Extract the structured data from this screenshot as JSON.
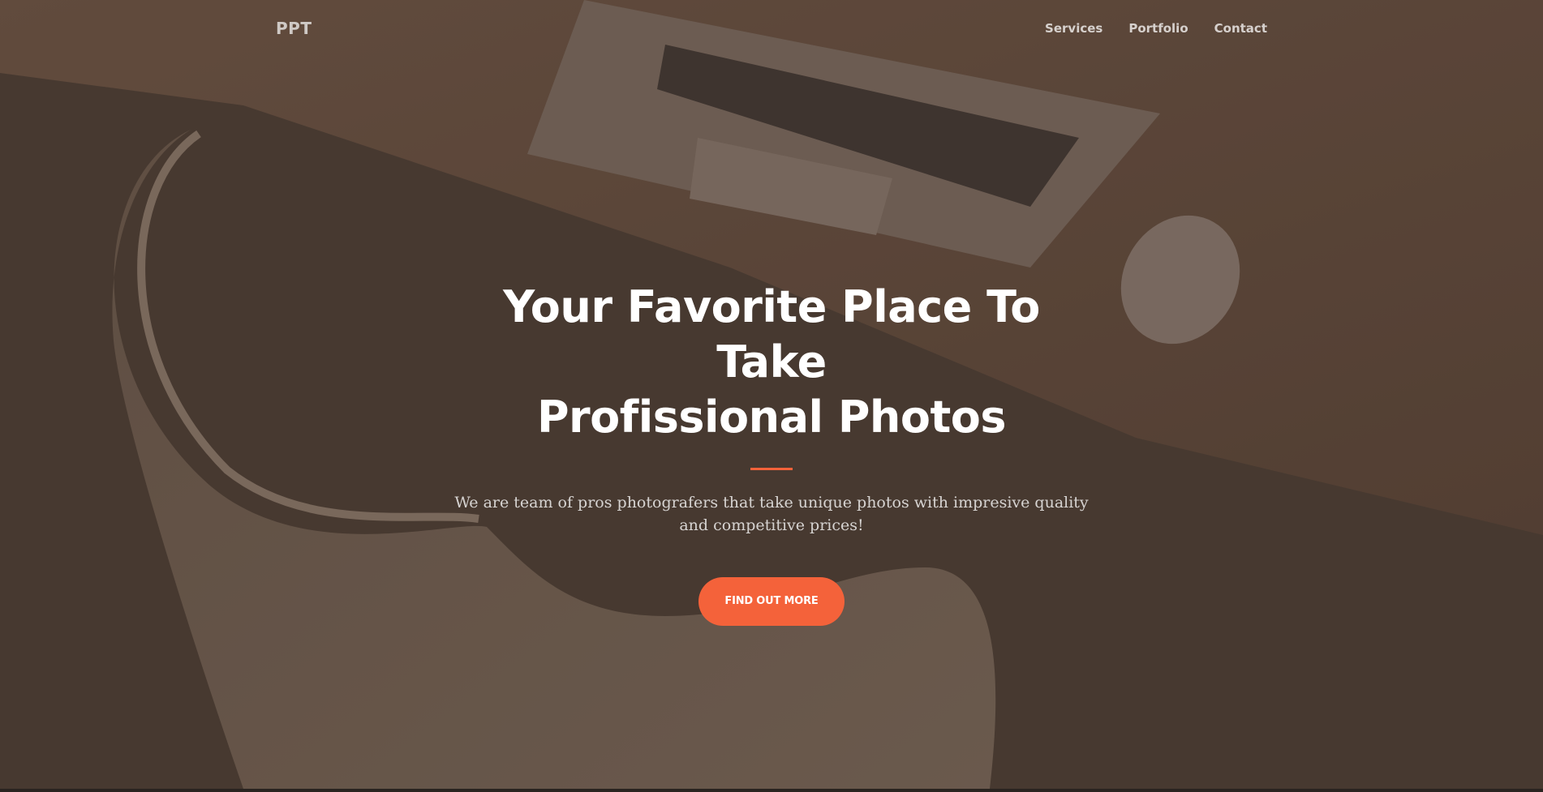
{
  "navbar": {
    "brand": "PPT",
    "links": [
      {
        "label": "Services"
      },
      {
        "label": "Portfolio"
      },
      {
        "label": "Contact"
      }
    ]
  },
  "hero": {
    "headline_line1": "Your Favorite Place To Take",
    "headline_line2": "Profissional Photos",
    "subtitle": "We are team of pros photografers that take unique photos with impresive quality and competitive prices!",
    "cta_label": "FIND OUT MORE"
  },
  "colors": {
    "accent": "#f4623a",
    "overlay": "#4a3c33",
    "text": "#ffffff"
  },
  "background_image": "desk-laptop-mouse-chair-photo"
}
